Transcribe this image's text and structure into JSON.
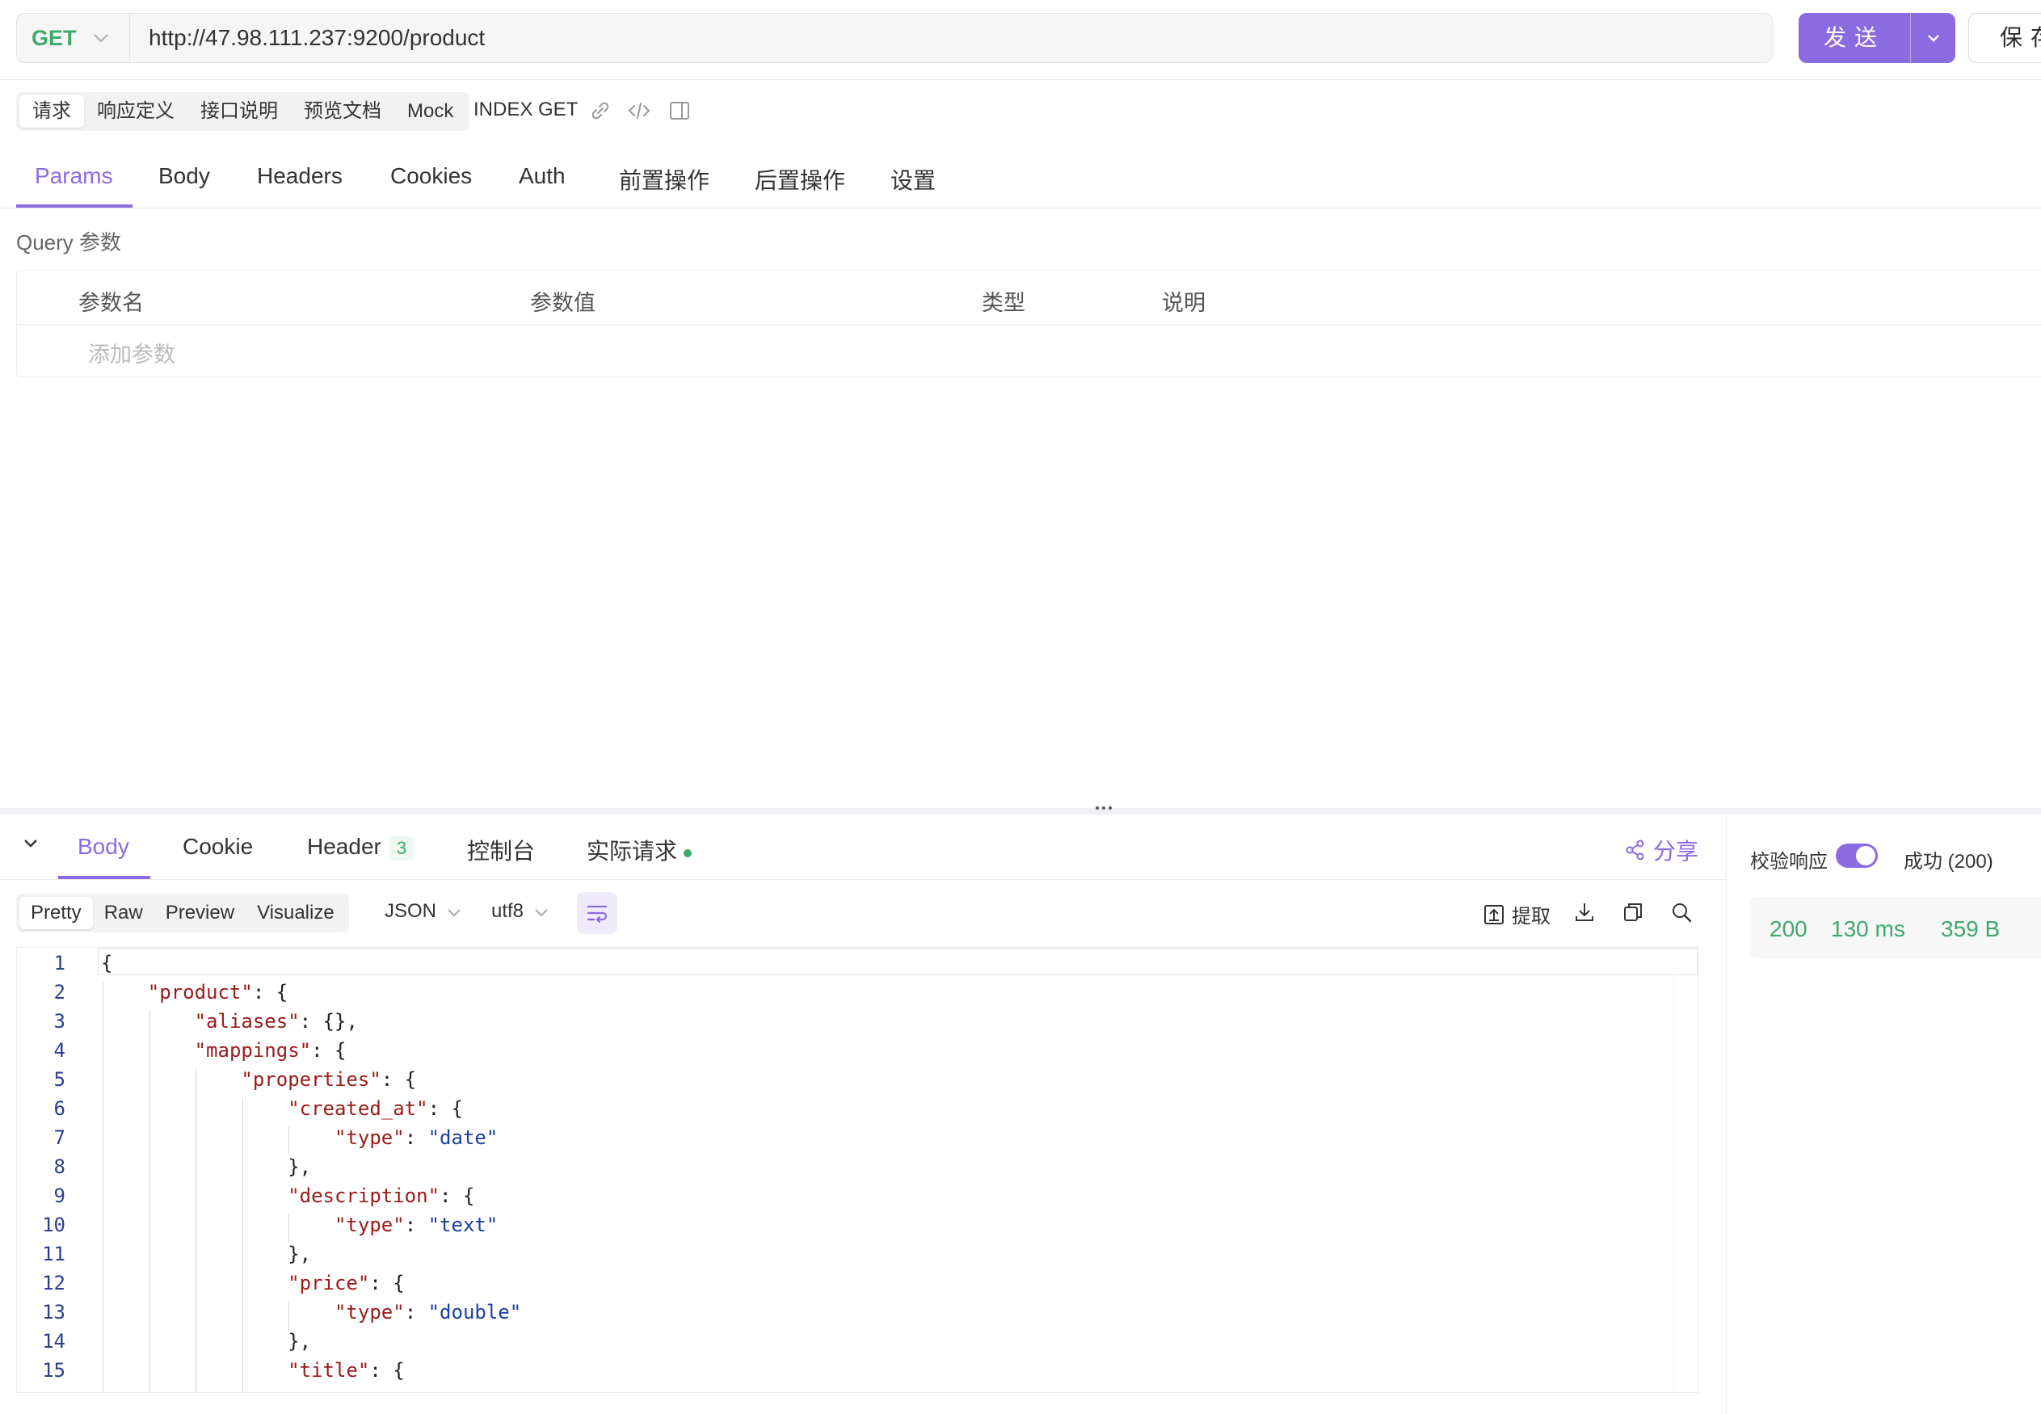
{
  "request": {
    "method": "GET",
    "url": "http://47.98.111.237:9200/product",
    "send_label": "发送",
    "save_label": "保存"
  },
  "seg_tabs": [
    "请求",
    "响应定义",
    "接口说明",
    "预览文档",
    "Mock"
  ],
  "api_name": "INDEX GET",
  "main_tabs": [
    "Params",
    "Body",
    "Headers",
    "Cookies",
    "Auth",
    "前置操作",
    "后置操作",
    "设置"
  ],
  "query": {
    "title": "Query 参数",
    "columns": [
      "参数名",
      "参数值",
      "类型",
      "说明"
    ],
    "add_placeholder": "添加参数"
  },
  "response": {
    "tabs": {
      "body": "Body",
      "cookie": "Cookie",
      "header": "Header",
      "header_count": "3",
      "console": "控制台",
      "actual": "实际请求"
    },
    "share_label": "分享",
    "formats": [
      "Pretty",
      "Raw",
      "Preview",
      "Visualize"
    ],
    "content_type": "JSON",
    "encoding": "utf8",
    "extract_label": "提取",
    "verify_label": "校验响应",
    "verify_status": "成功 (200)",
    "status_code": "200",
    "time": "130 ms",
    "size": "359 B"
  },
  "code_lines": [
    "{",
    "    \"product\": {",
    "        \"aliases\": {},",
    "        \"mappings\": {",
    "            \"properties\": {",
    "                \"created_at\": {",
    "                    \"type\": \"date\"",
    "                },",
    "                \"description\": {",
    "                    \"type\": \"text\"",
    "                },",
    "                \"price\": {",
    "                    \"type\": \"double\"",
    "                },",
    "                \"title\": {"
  ],
  "colors": {
    "accent": "#8c6ae0",
    "success": "#3fa86b",
    "json_key": "#9a1a1a",
    "json_string": "#1b3fa0"
  }
}
